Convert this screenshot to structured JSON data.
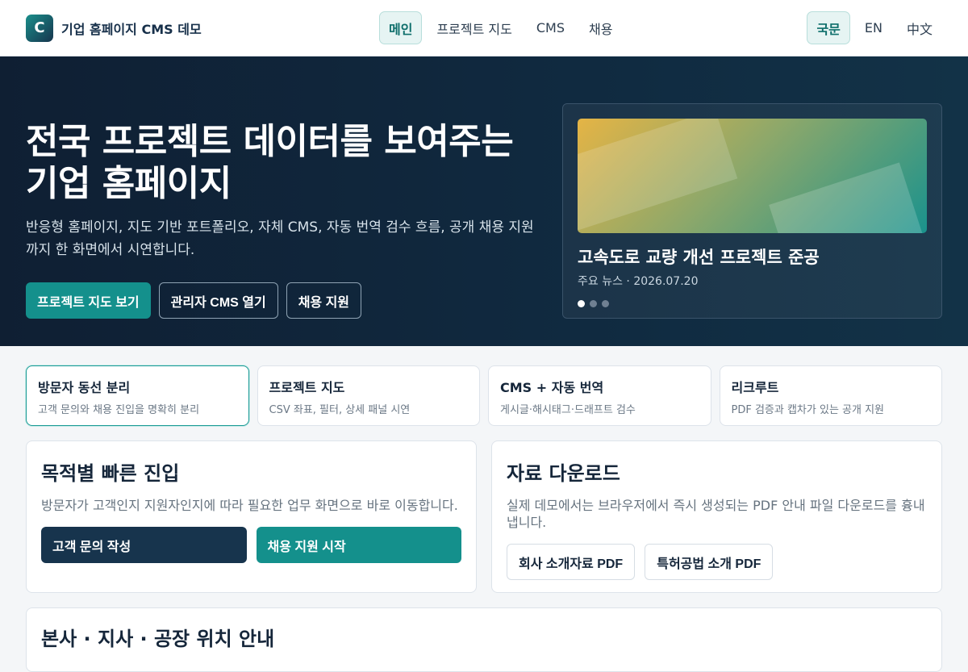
{
  "header": {
    "logo_letter": "C",
    "brand": "기업 홈페이지 CMS 데모",
    "nav": [
      {
        "label": "메인",
        "active": true
      },
      {
        "label": "프로젝트 지도",
        "active": false
      },
      {
        "label": "CMS",
        "active": false
      },
      {
        "label": "채용",
        "active": false
      }
    ],
    "languages": [
      {
        "label": "국문",
        "active": true
      },
      {
        "label": "EN",
        "active": false
      },
      {
        "label": "中文",
        "active": false
      }
    ]
  },
  "hero": {
    "title": "전국 프로젝트 데이터를 보여주는 기업 홈페이지",
    "description": "반응형 홈페이지, 지도 기반 포트폴리오, 자체 CMS, 자동 번역 검수 흐름, 공개 채용 지원까지 한 화면에서 시연합니다.",
    "buttons": {
      "map": "프로젝트 지도 보기",
      "cms": "관리자 CMS 열기",
      "recruit": "채용 지원"
    },
    "news": {
      "title": "고속도로 교량 개선 프로젝트 준공",
      "meta": "주요 뉴스 · 2026.07.20",
      "slide_count": 3,
      "active_slide": 1
    }
  },
  "features": [
    {
      "title": "방문자 동선 분리",
      "subtitle": "고객 문의와 채용 진입을 명확히 분리",
      "active": true
    },
    {
      "title": "프로젝트 지도",
      "subtitle": "CSV 좌표, 필터, 상세 패널 시연",
      "active": false
    },
    {
      "title": "CMS + 자동 번역",
      "subtitle": "게시글·해시태그·드래프트 검수",
      "active": false
    },
    {
      "title": "리크루트",
      "subtitle": "PDF 검증과 캡차가 있는 공개 지원",
      "active": false
    }
  ],
  "quick_entry": {
    "title": "목적별 빠른 진입",
    "description": "방문자가 고객인지 지원자인지에 따라 필요한 업무 화면으로 바로 이동합니다.",
    "inquiry_button": "고객 문의 작성",
    "apply_button": "채용 지원 시작"
  },
  "downloads": {
    "title": "자료 다운로드",
    "description": "실제 데모에서는 브라우저에서 즉시 생성되는 PDF 안내 파일 다운로드를 흉내냅니다.",
    "company_pdf": "회사 소개자료 PDF",
    "patent_pdf": "특허공법 소개 PDF"
  },
  "locations": {
    "title": "본사 · 지사 · 공장 위치 안내"
  },
  "colors": {
    "teal": "#14908c",
    "navy": "#17344d",
    "hero_bg": "#0f1f33"
  }
}
